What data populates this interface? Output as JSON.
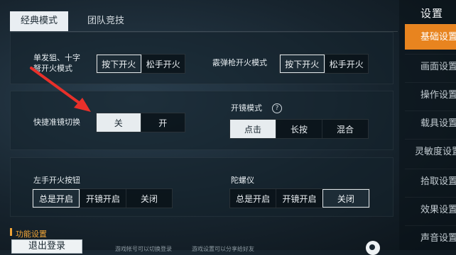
{
  "tabs": {
    "classic": "经典模式",
    "team": "团队竞技"
  },
  "rows": {
    "single_shot": {
      "label": "单发狙、十字\n弩开火模式",
      "options": [
        "按下开火",
        "松手开火"
      ],
      "selected": 0
    },
    "shotgun": {
      "label": "霰弹枪开火模式",
      "options": [
        "按下开火",
        "松手开火"
      ],
      "selected": 0
    },
    "quick_scope": {
      "label": "快捷准镜切换",
      "options": [
        "关",
        "开"
      ],
      "selected": 0
    },
    "scope_mode": {
      "label": "开镜模式",
      "help": "?",
      "options": [
        "点击",
        "长按",
        "混合"
      ],
      "selected": 0
    },
    "left_fire": {
      "label": "左手开火按钮",
      "options": [
        "总是开启",
        "开镜开启",
        "关闭"
      ],
      "selected": 0
    },
    "gyro": {
      "label": "陀螺仪",
      "options": [
        "总是开启",
        "开镜开启",
        "关闭"
      ],
      "selected": 2
    }
  },
  "sidebar": {
    "title": "设置",
    "items": [
      "基础设置",
      "画面设置",
      "操作设置",
      "载具设置",
      "灵敏度设置",
      "拾取设置",
      "效果设置",
      "声音设置"
    ],
    "active": 0
  },
  "bottom": {
    "section_title": "功能设置",
    "logout_label": "退出登录",
    "note1": "游戏帐号可以切换登录",
    "note2": "游戏设置可以分享给好友"
  },
  "colors": {
    "accent": "#e8841f",
    "selected": "#e7ecef",
    "feature": "#f0a437"
  }
}
